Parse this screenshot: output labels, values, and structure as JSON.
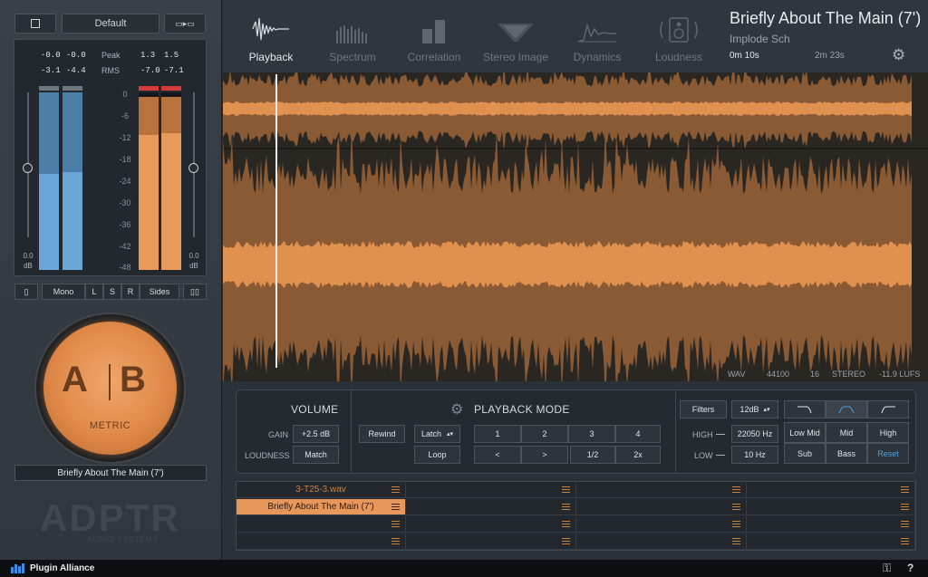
{
  "top_left": {
    "preset": "Default"
  },
  "meters": {
    "peak_label": "Peak",
    "rms_label": "RMS",
    "left_peak": [
      "-0.0",
      "-0.0"
    ],
    "left_rms": [
      "-3.1",
      "-4.4"
    ],
    "right_peak": [
      "1.3",
      "1.5"
    ],
    "right_rms": [
      "-7.0",
      "-7.1"
    ],
    "scale": [
      "0",
      "-6",
      "-12",
      "-18",
      "-24",
      "-30",
      "-36",
      "-42",
      "-48"
    ],
    "left_gain": "0.0",
    "right_gain": "0.0",
    "unit": "dB",
    "colors": {
      "a": "#6aa6d8",
      "b": "#e79a5a",
      "clip": "#d63b3b"
    }
  },
  "monitor": {
    "mono": "Mono",
    "l": "L",
    "s": "S",
    "r": "R",
    "sides": "Sides"
  },
  "ab": {
    "a": "A",
    "b": "B",
    "mode": "METRIC",
    "current_track": "Briefly About The Main (7')"
  },
  "brand": {
    "logo": "ADPTR",
    "sub": "AUDIO SYSTEMS",
    "footer": "Plugin Alliance"
  },
  "nav": {
    "tabs": [
      "Playback",
      "Spectrum",
      "Correlation",
      "Stereo Image",
      "Dynamics",
      "Loudness"
    ],
    "active": "Playback"
  },
  "song": {
    "title": "Briefly About The Main (7')",
    "artist": "Implode Sch",
    "current_time": "0m 10s",
    "total_time": "2m 23s"
  },
  "file_info": {
    "format": "WAV",
    "sample_rate": "44100",
    "bit_depth": "16",
    "channels": "STEREO",
    "loudness": "-11.9 LUFS"
  },
  "volume": {
    "title": "VOLUME",
    "gain_label": "GAIN",
    "gain_value": "+2.5 dB",
    "loudness_label": "LOUDNESS",
    "match": "Match"
  },
  "playback_mode": {
    "title": "PLAYBACK MODE",
    "rewind": "Rewind",
    "latch": "Latch",
    "loop": "Loop",
    "markers": [
      "1",
      "2",
      "3",
      "4"
    ],
    "prev": "<",
    "next": ">",
    "half": "1/2",
    "double": "2x"
  },
  "filters": {
    "title": "Filters",
    "slope": "12dB",
    "high_label": "HIGH",
    "high_value": "22050 Hz",
    "low_label": "LOW",
    "low_value": "10 Hz",
    "bands": [
      "Low Mid",
      "Mid",
      "High",
      "Sub",
      "Bass",
      "Reset"
    ]
  },
  "playlist": {
    "slots": [
      "3-T25-3.wav",
      "",
      "",
      "",
      "Briefly About The Main (7')",
      "",
      "",
      "",
      "",
      "",
      "",
      "",
      "",
      "",
      "",
      ""
    ],
    "active_index": 4
  }
}
